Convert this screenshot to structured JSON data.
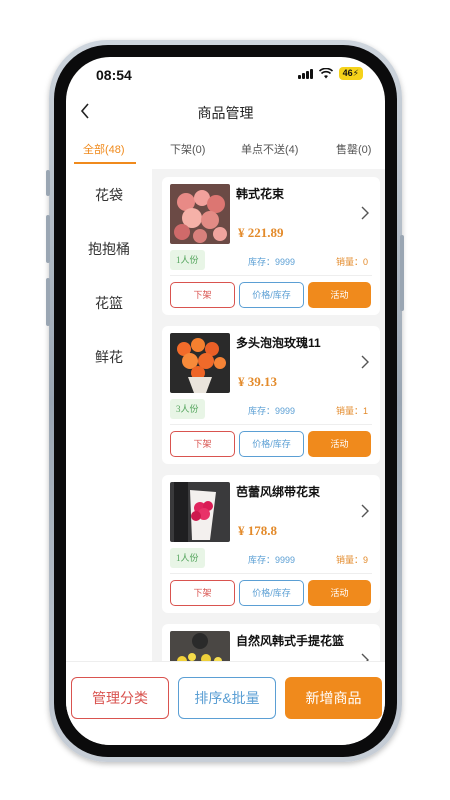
{
  "status_bar": {
    "time": "08:54",
    "network": "46"
  },
  "header": {
    "title": "商品管理"
  },
  "tabs": [
    {
      "label": "全部(48)",
      "active": true
    },
    {
      "label": "下架(0)",
      "active": false
    },
    {
      "label": "单点不送(4)",
      "active": false
    },
    {
      "label": "售罄(0)",
      "active": false
    }
  ],
  "categories": [
    "花袋",
    "抱抱桶",
    "花篮",
    "鲜花"
  ],
  "products": [
    {
      "name": "韩式花束",
      "price": "¥ 221.89",
      "serving": "1人份",
      "stock": "库存：9999",
      "sales": "销量：0",
      "btn_off": "下架",
      "btn_price": "价格/库存",
      "btn_activity": "活动"
    },
    {
      "name": "多头泡泡玫瑰11",
      "price": "¥ 39.13",
      "serving": "3人份",
      "stock": "库存：9999",
      "sales": "销量：1",
      "btn_off": "下架",
      "btn_price": "价格/库存",
      "btn_activity": "活动"
    },
    {
      "name": "芭蕾风绑带花束",
      "price": "¥ 178.8",
      "serving": "1人份",
      "stock": "库存：9999",
      "sales": "销量：9",
      "btn_off": "下架",
      "btn_price": "价格/库存",
      "btn_activity": "活动"
    },
    {
      "name": "自然风韩式手提花篮"
    }
  ],
  "bottom_bar": {
    "manage_category": "管理分类",
    "sort_batch": "排序&批量",
    "add_product": "新增商品"
  },
  "colors": {
    "accent": "#f08a1c",
    "danger": "#d9534f",
    "info": "#5b9fd4",
    "success": "#51a35a"
  }
}
